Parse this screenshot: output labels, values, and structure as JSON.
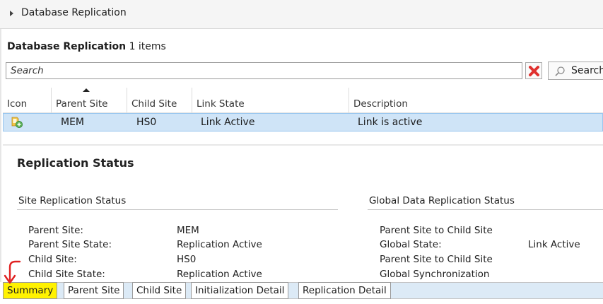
{
  "breadcrumb": {
    "label": "Database Replication"
  },
  "list": {
    "title": "Database Replication",
    "count_label": "1 items"
  },
  "search": {
    "placeholder": "Search",
    "value": "",
    "button_label": "Search"
  },
  "table": {
    "columns": [
      "Icon",
      "Parent Site",
      "Child Site",
      "Link State",
      "Description"
    ],
    "sorted_column": "Parent Site",
    "rows": [
      {
        "icon": "replication-link-icon",
        "parent_site": "MEM",
        "child_site": "HS0",
        "link_state": "Link Active",
        "description": "Link is active"
      }
    ]
  },
  "details": {
    "title": "Replication Status",
    "site_section": {
      "title": "Site Replication Status",
      "items": [
        {
          "label": "Parent Site:",
          "value": "MEM"
        },
        {
          "label": "Parent Site State:",
          "value": "Replication Active"
        },
        {
          "label": "Child Site:",
          "value": "HS0"
        },
        {
          "label": "Child Site State:",
          "value": "Replication Active"
        }
      ]
    },
    "global_section": {
      "title": "Global Data Replication Status",
      "items": [
        {
          "label": "Parent Site to Child Site",
          "value": ""
        },
        {
          "label": "Global State:",
          "value": "Link Active"
        },
        {
          "label": "Parent Site to Child Site",
          "value": ""
        },
        {
          "label": "Global Synchronization",
          "value": ""
        }
      ]
    }
  },
  "tabs": [
    {
      "label": "Summary",
      "active": true
    },
    {
      "label": "Parent Site",
      "active": false
    },
    {
      "label": "Child Site",
      "active": false
    },
    {
      "label": "Initialization Detail",
      "active": false
    },
    {
      "label": "Replication Detail",
      "active": false
    }
  ],
  "colors": {
    "selected_row": "#cfe4f7",
    "tab_strip": "#dceaf6",
    "highlight": "#fff200",
    "annotation_arrow": "#e02020",
    "clear_icon": "#e0312f"
  },
  "icons": {
    "breadcrumb": "expand-chevron-icon",
    "clear": "clear-x-icon",
    "search": "magnifier-icon",
    "row": "replication-link-icon",
    "annotation": "red-arrow-icon"
  }
}
